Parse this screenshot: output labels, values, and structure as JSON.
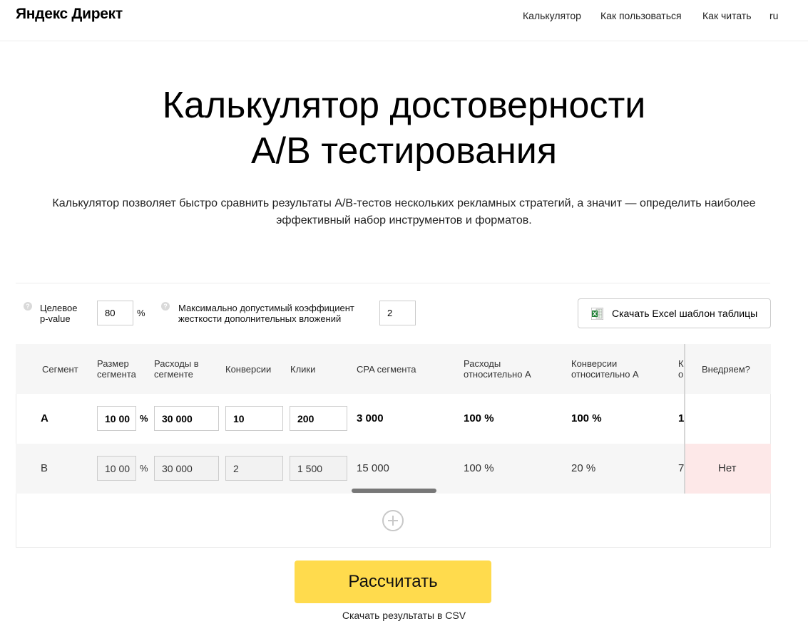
{
  "header": {
    "logo": "Яндекс Директ",
    "nav": [
      "Калькулятор",
      "Как пользоваться",
      "Как читать",
      "ru"
    ]
  },
  "hero": {
    "title_line1": "Калькулятор достоверности",
    "title_line2": "A/B тестирования",
    "subtitle_line1": "Калькулятор позволяет быстро сравнить результаты A/B-тестов нескольких рекламных стратегий, а значит — определить наиболее",
    "subtitle_line2": "эффективный набор инструментов и форматов."
  },
  "settings": {
    "help_glyph": "?",
    "pvalue_label_1": "Целевое",
    "pvalue_label_2": "p-value",
    "pvalue_value": "80",
    "pvalue_unit": "%",
    "coef_label_1": "Максимально допустимый коэффициент",
    "coef_label_2": "жесткости дополнительных вложений",
    "coef_value": "2",
    "excel_button": "Скачать Excel шаблон таблицы"
  },
  "table": {
    "headers": {
      "segment": "Сегмент",
      "size_1": "Размер",
      "size_2": "сегмента",
      "spend_1": "Расходы в",
      "spend_2": "сегменте",
      "conversions": "Конверсии",
      "clicks": "Клики",
      "cpa": "CPA сегмента",
      "spend_rel_1": "Расходы",
      "spend_rel_2": "относительно A",
      "conv_rel_1": "Конверсии",
      "conv_rel_2": "относительно A",
      "cut_1": "К",
      "cut_2": "о",
      "implement": "Внедряем?"
    },
    "rows": [
      {
        "segment": "A",
        "size": "10 00",
        "unit": "%",
        "spend": "30 000",
        "conversions": "10",
        "clicks": "200",
        "cpa": "3 000",
        "spend_rel": "100 %",
        "conv_rel": "100 %",
        "cut": "1",
        "implement": ""
      },
      {
        "segment": "B",
        "size": "10 00",
        "unit": "%",
        "spend": "30 000",
        "conversions": "2",
        "clicks": "1 500",
        "cpa": "15 000",
        "spend_rel": "100 %",
        "conv_rel": "20 %",
        "cut": "7",
        "implement": "Нет"
      }
    ]
  },
  "actions": {
    "calculate": "Рассчитать",
    "download_csv": "Скачать результаты в CSV"
  }
}
